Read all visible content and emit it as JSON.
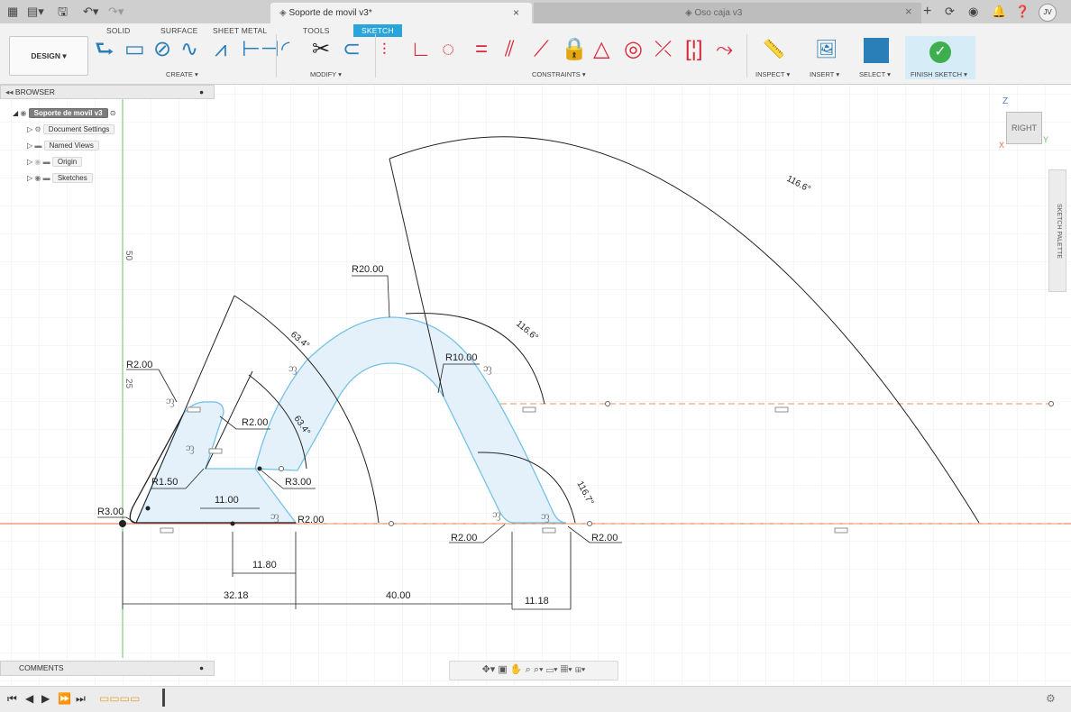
{
  "titlebar": {
    "doc_tab_title": "Soporte de movil v3*",
    "doc_tab_close": "×",
    "other_tab_title": "Oso caja v3",
    "other_tab_close": "×",
    "new_tab": "+",
    "user_initials": "JV"
  },
  "toolbar": {
    "workspace_tabs": [
      "SOLID",
      "SURFACE",
      "SHEET METAL",
      "TOOLS",
      "SKETCH"
    ],
    "active_tab": "SKETCH",
    "design_button": "DESIGN ▾",
    "groups": {
      "create": "CREATE ▾",
      "modify": "MODIFY ▾",
      "constraints": "CONSTRAINTS ▾",
      "inspect": "INSPECT ▾",
      "insert": "INSERT ▾",
      "select": "SELECT ▾",
      "finish": "FINISH SKETCH ▾"
    }
  },
  "browser": {
    "header": "BROWSER",
    "root": "Soporte de movil v3",
    "items": [
      "Document Settings",
      "Named Views",
      "Origin",
      "Sketches"
    ]
  },
  "comments": {
    "label": "COMMENTS"
  },
  "viewcube": {
    "face": "RIGHT",
    "axis_z": "Z",
    "axis_y": "Y",
    "axis_x": "X"
  },
  "sketch_palette": {
    "label": "SKETCH PALETTE"
  },
  "sketch": {
    "axis_label_50": "50",
    "axis_label_25": "25",
    "dimensions": {
      "r20": "R20.00",
      "r10": "R10.00",
      "r2_left_top": "R2.00",
      "r2_inner": "R2.00",
      "r1_5": "R1.50",
      "r3_inner": "R3.00",
      "r3_left": "R3.00",
      "r2_base": "R2.00",
      "r2_right_a": "R2.00",
      "r2_right_b": "R2.00",
      "d11": "11.00",
      "d11_80": "11.80",
      "d32_18": "32.18",
      "d40": "40.00",
      "d11_18": "11.18",
      "a63_outer": "63.4°",
      "a63_inner": "63.4°",
      "a116_big": "116.6°",
      "a116_mid": "116.6°",
      "a116_7": "116.7°"
    }
  },
  "colors": {
    "accent": "#29a5dc",
    "finish_green": "#3daf4e",
    "sketch_fill": "#e4f1fb",
    "sketch_line": "#74c1e8",
    "x_axis": "#e86a4a",
    "y_axis": "#69c069",
    "constraint_red": "#d9283a"
  }
}
